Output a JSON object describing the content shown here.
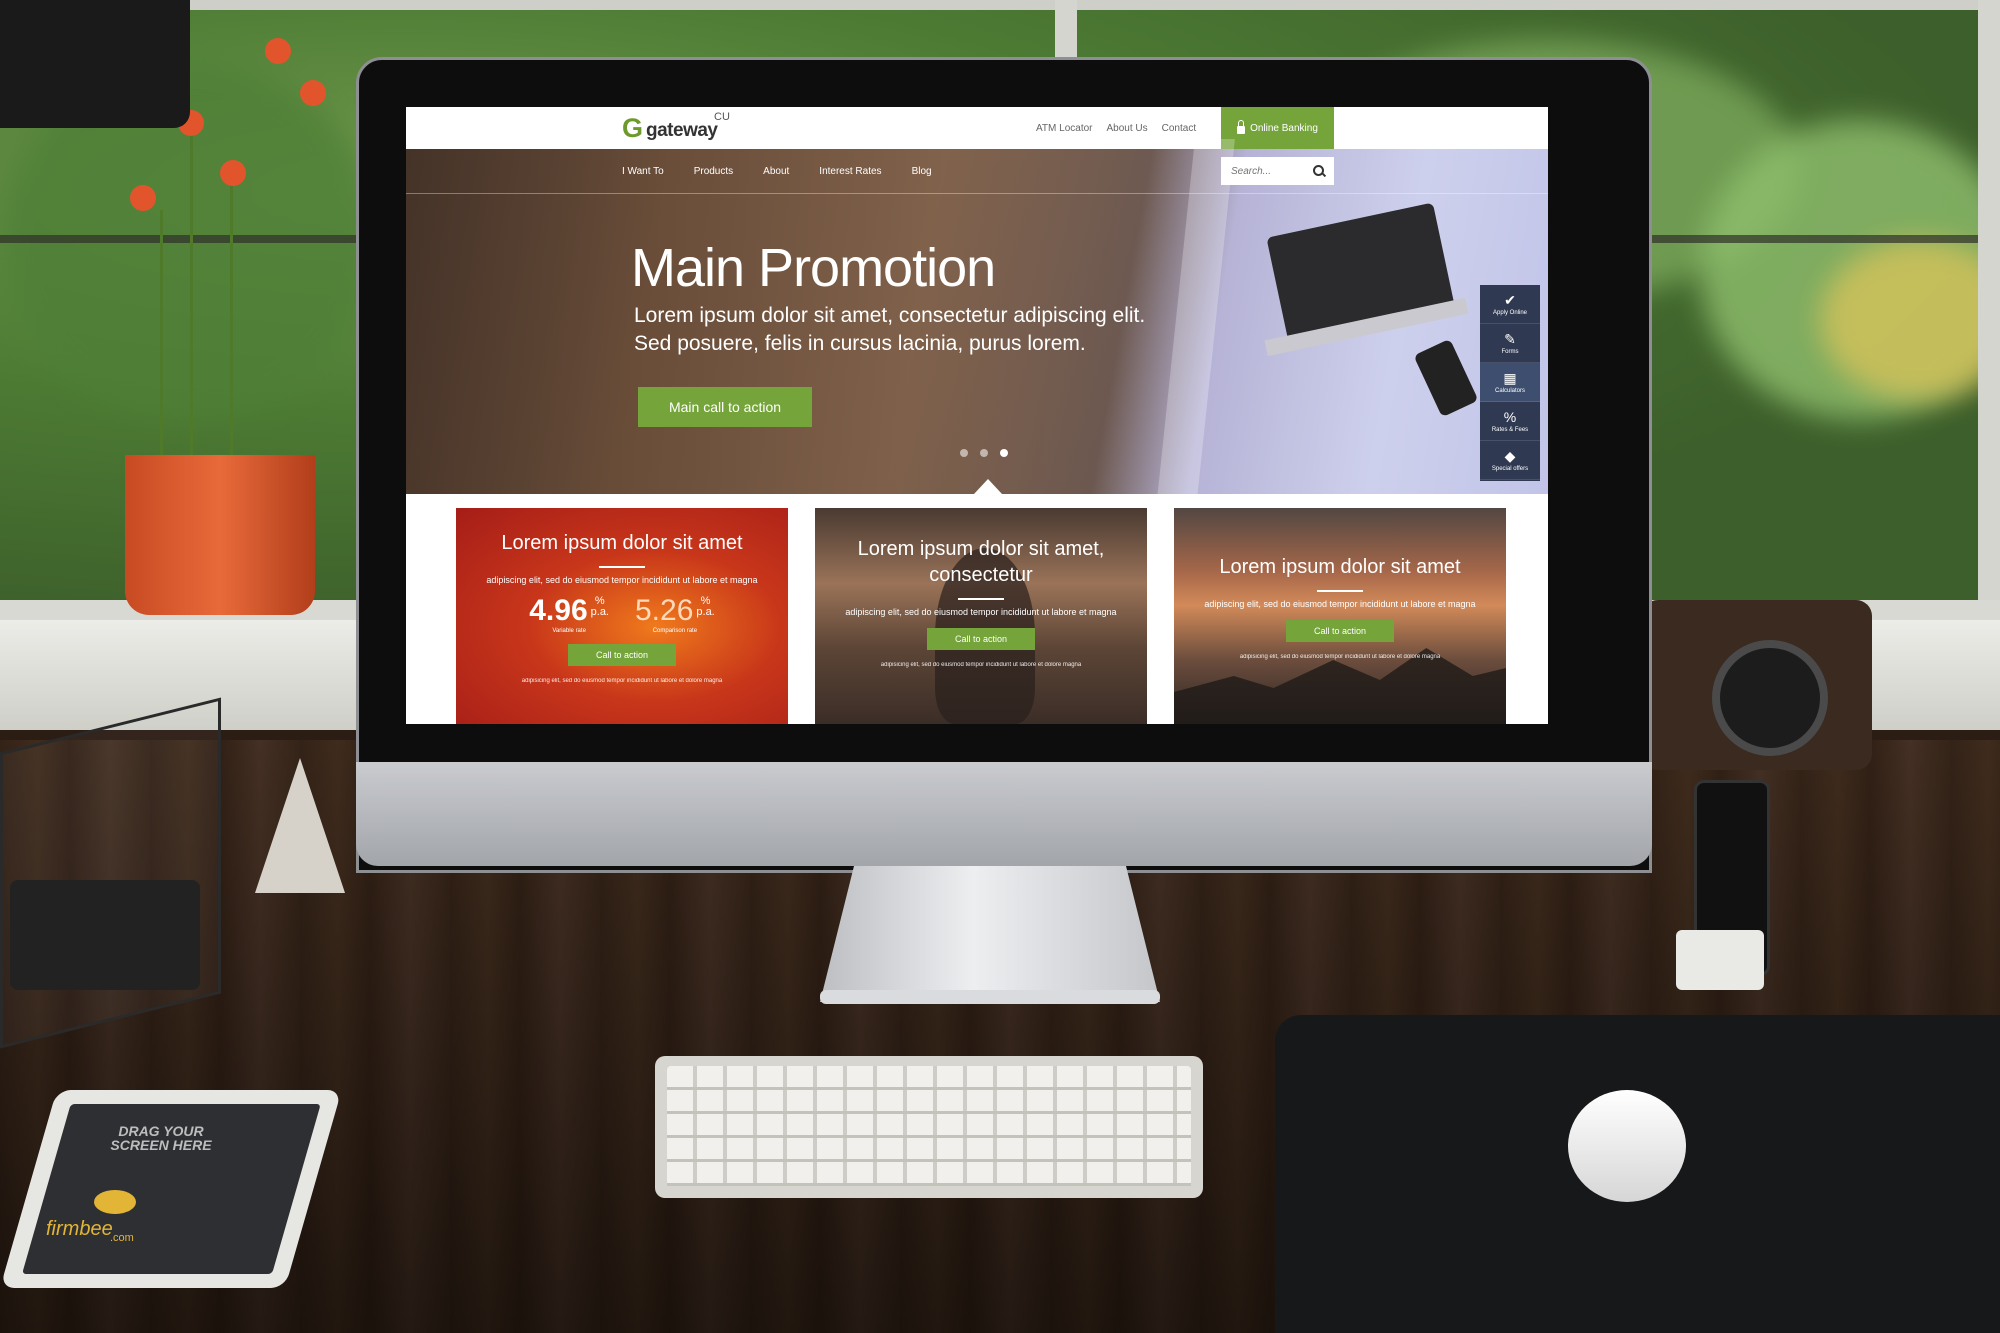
{
  "colors": {
    "brand_green": "#74a43a",
    "sidebar_navy": "#2f3a52"
  },
  "icons": {
    "lock": "lock-icon",
    "search": "search-icon",
    "apply_online": "checkmark-icon",
    "forms": "edit-icon",
    "calculators": "calculator-icon",
    "rates_fees": "percent-icon",
    "special_offers": "tag-icon"
  },
  "site": {
    "logo": {
      "mark": "G",
      "word": "gateway",
      "suffix": "CU"
    },
    "top_links": [
      "ATM Locator",
      "About Us",
      "Contact"
    ],
    "online_banking": "Online Banking",
    "nav": [
      "I Want To",
      "Products",
      "About",
      "Interest Rates",
      "Blog"
    ],
    "search": {
      "placeholder": "Search..."
    },
    "hero": {
      "title": "Main Promotion",
      "text": "Lorem ipsum dolor sit amet, consectetur adipiscing elit. Sed posuere, felis in cursus lacinia, purus lorem.",
      "cta": "Main call to action",
      "slides": 3,
      "active_slide": 3
    },
    "tools": [
      {
        "label": "Apply Online",
        "icon": "✔"
      },
      {
        "label": "Forms",
        "icon": "✎"
      },
      {
        "label": "Calculators",
        "icon": "▦"
      },
      {
        "label": "Rates & Fees",
        "icon": "%"
      },
      {
        "label": "Special offers",
        "icon": "◆"
      }
    ],
    "cards": [
      {
        "title": "Lorem ipsum dolor sit amet",
        "text": "adipiscing elit, sed do eiusmod tempor incididunt ut labore et magna",
        "rates": [
          {
            "value": "4.96",
            "suffix_top": "%",
            "suffix_bottom": "p.a.",
            "label": "Variable rate"
          },
          {
            "value": "5.26",
            "suffix_top": "%",
            "suffix_bottom": "p.a.",
            "label": "Comparison rate"
          }
        ],
        "cta": "Call to action",
        "footnote": "adipisicing elit, sed do eiusmod tempor incididunt ut labore et dolore magna"
      },
      {
        "title": "Lorem ipsum dolor sit amet, consectetur",
        "text": "adipiscing elit, sed do eiusmod tempor incididunt ut labore et magna",
        "cta": "Call to action",
        "footnote": "adipisicing elit, sed do eiusmod tempor incididunt ut labore et dolore magna"
      },
      {
        "title": "Lorem ipsum dolor sit amet",
        "text": "adipiscing elit, sed do eiusmod tempor incididunt ut labore et magna",
        "cta": "Call to action",
        "footnote": "adipisicing elit, sed do eiusmod tempor incididunt ut labore et dolore magna"
      }
    ]
  },
  "tablet": {
    "text": "DRAG YOUR SCREEN HERE",
    "brand": "firmbee",
    "brand_sub": ".com"
  }
}
